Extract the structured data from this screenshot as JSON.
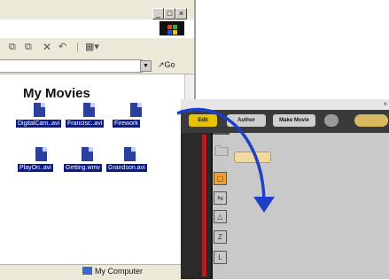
{
  "explorer": {
    "folder_title": "My Movies",
    "files": [
      {
        "label": "DigitalCam..avi"
      },
      {
        "label": "Francisc..avi"
      },
      {
        "label": "Firework"
      },
      {
        "label": "PlayOn..avi"
      },
      {
        "label": "Getting.wmv"
      },
      {
        "label": "Grandson.avi"
      }
    ],
    "address_go": "Go",
    "status_location": "My Computer",
    "window_buttons": {
      "minimize": "_",
      "restore": "□",
      "close": "×"
    }
  },
  "moviemaker": {
    "tabs": {
      "edit": "Edit",
      "author": "Author",
      "make_movie": "Make Movie"
    }
  },
  "colors": {
    "selection_blue": "#0a1a8a",
    "arrow_blue": "#1f3fc8",
    "edit_tab_yellow": "#e8c200"
  }
}
